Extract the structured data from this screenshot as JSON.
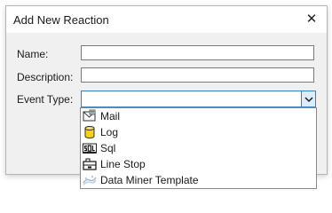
{
  "dialog": {
    "title": "Add New Reaction",
    "close_glyph": "✕"
  },
  "form": {
    "name_label": "Name:",
    "name_value": "",
    "description_label": "Description:",
    "description_value": "",
    "event_type_label": "Event Type:",
    "event_type_value": ""
  },
  "dropdown": {
    "options": [
      {
        "label": "Mail",
        "icon": "mail-icon"
      },
      {
        "label": "Log",
        "icon": "log-icon"
      },
      {
        "label": "Sql",
        "icon": "sql-icon"
      },
      {
        "label": "Line Stop",
        "icon": "line-stop-icon"
      },
      {
        "label": "Data Miner Template",
        "icon": "data-miner-template-icon"
      }
    ]
  },
  "colors": {
    "accent": "#3c7fb1",
    "combo_button_bg": "#dcecfc",
    "dialog_bg": "#f0f0f0",
    "log_icon_fill": "#f5d21b"
  }
}
